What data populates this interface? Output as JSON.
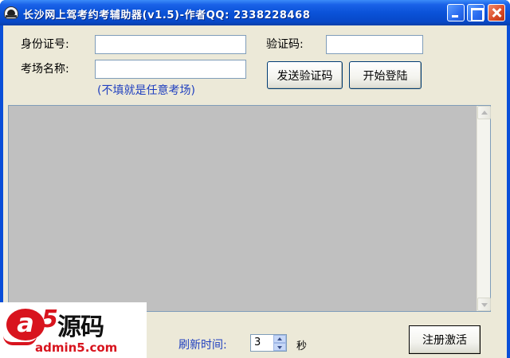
{
  "window": {
    "title": "长沙网上驾考约考辅助器(v1.5)-作者QQ: 2338228468"
  },
  "form": {
    "id_label": "身份证号:",
    "id_value": "",
    "captcha_label": "验证码:",
    "captcha_value": "",
    "venue_label": "考场名称:",
    "venue_value": "",
    "venue_hint": "(不填就是任意考场)",
    "send_captcha_button": "发送验证码",
    "start_login_button": "开始登陆"
  },
  "footer": {
    "refresh_label": "刷新时间:",
    "refresh_value": "3",
    "refresh_unit": "秒",
    "register_button": "注册激活"
  },
  "watermark": {
    "brand": "a5源码",
    "url": "admin5.com"
  },
  "colors": {
    "title_bar": "#0a52d8",
    "client_bg": "#ece9d8",
    "log_bg": "#c0c0c0",
    "label_blue": "#1f3fbf",
    "watermark_red": "#d8141e"
  },
  "icons": [
    "app-icon",
    "minimize-icon",
    "maximize-icon",
    "close-icon",
    "scroll-up-icon",
    "scroll-down-icon",
    "spin-up-icon",
    "spin-down-icon"
  ]
}
